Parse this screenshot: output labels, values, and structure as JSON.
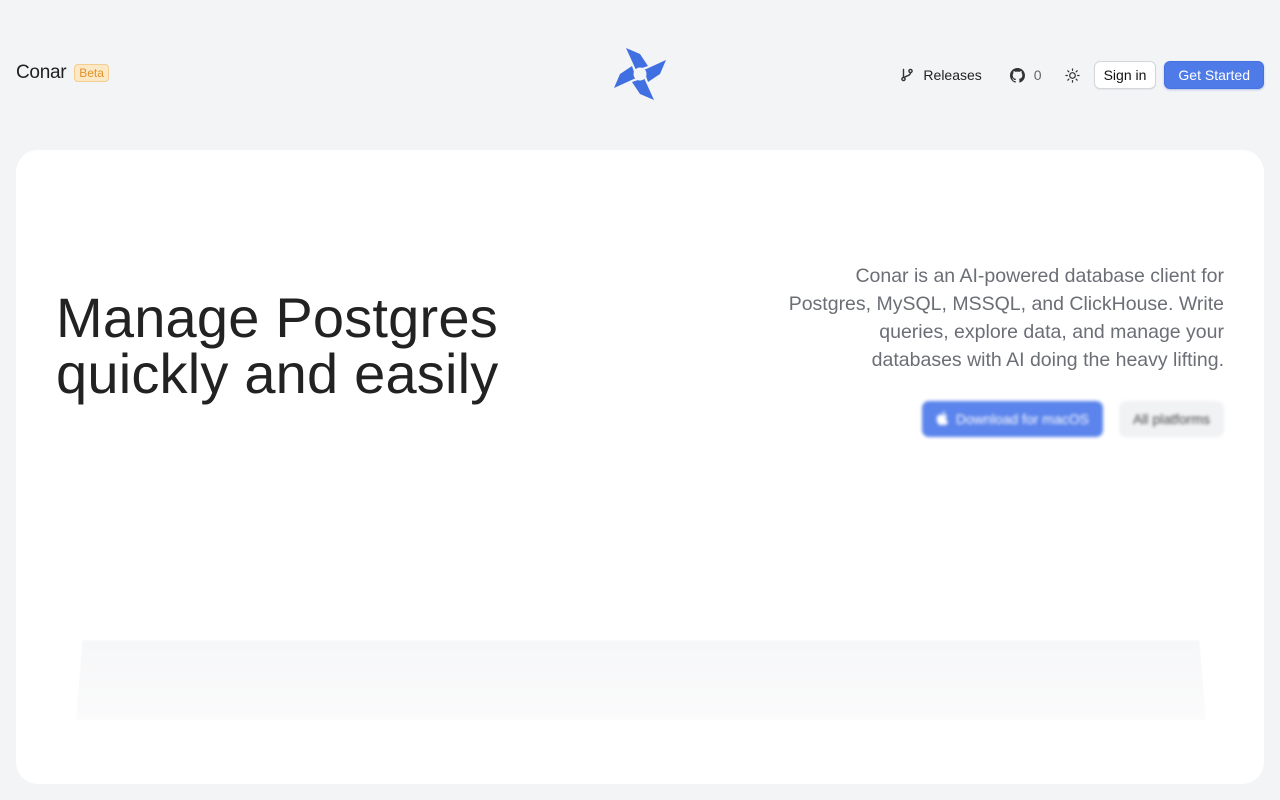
{
  "brand": {
    "name": "Conar",
    "badge": "Beta"
  },
  "colors": {
    "accent": "#4f7be8",
    "logo": "#3f6fe0",
    "badge": "#e0922a"
  },
  "nav": {
    "releases_label": "Releases",
    "github_stars": "0",
    "theme_icon": "sun-icon",
    "signin_label": "Sign in",
    "get_started_label": "Get Started"
  },
  "hero": {
    "headline_line1": "Manage Postgres",
    "headline_line2": "quickly and easily",
    "description": "Conar is an AI-powered database client for Postgres, MySQL, MSSQL, and ClickHouse. Write queries, explore data, and manage your databases with AI doing the heavy lifting.",
    "download_label": "Download for macOS",
    "all_platforms_label": "All platforms"
  }
}
